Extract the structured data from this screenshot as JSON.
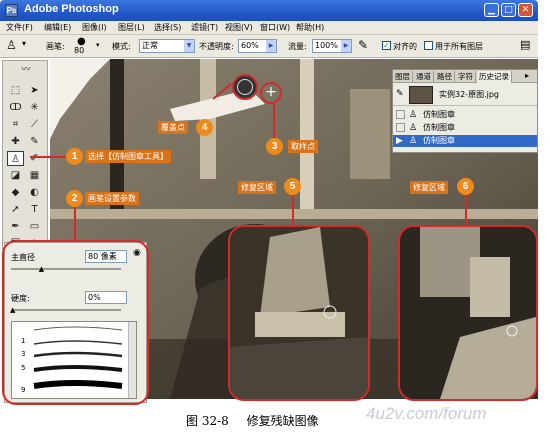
{
  "window": {
    "app_icon": "Ps",
    "title": "Adobe Photoshop",
    "minimize_icon": "minimize-icon",
    "maximize_icon": "maximize-icon",
    "close_icon": "close-icon"
  },
  "menu": [
    "文件(F)",
    "编辑(E)",
    "图像(I)",
    "图层(L)",
    "选择(S)",
    "滤镜(T)",
    "视图(V)",
    "窗口(W)",
    "帮助(H)"
  ],
  "options_bar": {
    "brush_label": "画笔:",
    "brush_size": "80",
    "mode_label": "模式:",
    "mode_value": "正常",
    "opacity_label": "不透明度:",
    "opacity_value": "60%",
    "flow_label": "流量:",
    "flow_value": "100%",
    "aligned_label": "对齐的",
    "aligned_checked": true,
    "all_layers_label": "用于所有图层",
    "all_layers_checked": false
  },
  "history_panel": {
    "tabs": [
      "图层",
      "通道",
      "路径",
      "字符",
      "历史记录"
    ],
    "active_tab": "历史记录",
    "snapshot_name": "实例32-原图.jpg",
    "steps": [
      "仿制图章",
      "仿制图章",
      "仿制图章"
    ],
    "selected_step": 2
  },
  "brush_panel": {
    "diameter_label": "主直径",
    "diameter_value": "80 像素",
    "diameter_slider_fraction": 0.28,
    "hardness_label": "硬度:",
    "hardness_value": "0%",
    "hardness_slider_fraction": 0.0,
    "preset_numbers": [
      "1",
      "3",
      "5",
      "9"
    ]
  },
  "annotations": [
    {
      "number": "1",
      "text": "选择【仿制图章工具】"
    },
    {
      "number": "2",
      "text": "画笔设置参数"
    },
    {
      "number": "3",
      "text": "取样点"
    },
    {
      "number": "4",
      "text": "覆盖点"
    },
    {
      "number": "5",
      "text": "修复区域"
    },
    {
      "number": "6",
      "text": "修复区域"
    }
  ],
  "caption": {
    "figure_no": "图 32-8",
    "text": "修复残缺图像"
  },
  "watermark": "4u2v.com/forum",
  "colors": {
    "titlebar": "#2358c8",
    "annotation_orange": "#f08a1a",
    "highlight_red": "#d42a2a",
    "selection_blue": "#316ac5"
  }
}
